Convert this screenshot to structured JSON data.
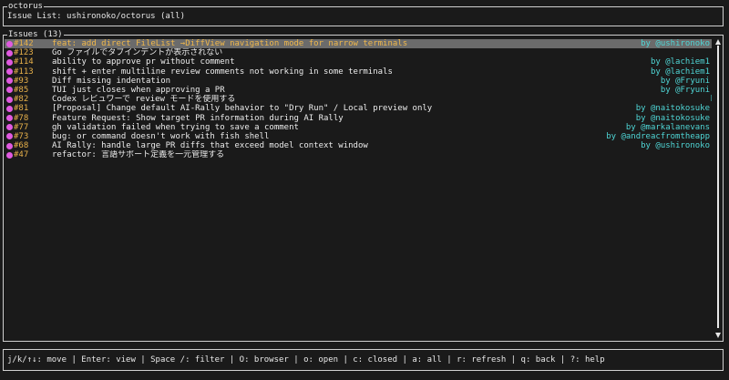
{
  "app": {
    "name": "octorus",
    "header": "Issue List: ushironoko/octorus (all)"
  },
  "issues": {
    "panel_title": "Issues (13)",
    "selected_index": 0,
    "items": [
      {
        "number": "#142",
        "title": "feat: add direct FileList →DiffView navigation mode for narrow terminals",
        "author": "by @ushironoko"
      },
      {
        "number": "#123",
        "title": "Go ファイルでタブインデントが表示されない",
        "author": ""
      },
      {
        "number": "#114",
        "title": "ability to approve pr without comment",
        "author": "by @lachiem1"
      },
      {
        "number": "#113",
        "title": "shift + enter multiline review comments not working in some terminals",
        "author": "by @lachiem1"
      },
      {
        "number": "#93",
        "title": "Diff missing indentation",
        "author": "by @Fryuni"
      },
      {
        "number": "#85",
        "title": "TUI just closes when approving a PR",
        "author": "by @Fryuni"
      },
      {
        "number": "#82",
        "title": "Codex レビュワーで review モードを使用する",
        "author": "b"
      },
      {
        "number": "#81",
        "title": "[Proposal] Change default AI-Rally behavior to \"Dry Run\" / Local preview only",
        "author": "by @naitokosuke"
      },
      {
        "number": "#78",
        "title": "Feature Request: Show target PR information during AI Rally",
        "author": "by @naitokosuke"
      },
      {
        "number": "#77",
        "title": "gh validation failed when trying to save a comment",
        "author": "by @markalanevans"
      },
      {
        "number": "#73",
        "title": "bug: or command doesn't work with fish shell",
        "author": "by @andreacfromtheapp"
      },
      {
        "number": "#68",
        "title": "AI Rally: handle large PR diffs that exceed model context window",
        "author": "by @ushironoko"
      },
      {
        "number": "#47",
        "title": "refactor: 言語サポート定義を一元管理する",
        "author": ""
      }
    ]
  },
  "footer": {
    "help": "j/k/↑↓: move | Enter: view | Space /: filter | O: browser | o: open | c: closed | a: all | r: refresh | q: back | ?: help"
  },
  "colors": {
    "background": "#1a1a1a",
    "border": "#cfcfcf",
    "issue_number": "#e8b14a",
    "author": "#4fd6d6",
    "open_status_dot": "#e05ae0",
    "selected_row": "#6b6b6b",
    "selected_title": "#f0b84c"
  }
}
